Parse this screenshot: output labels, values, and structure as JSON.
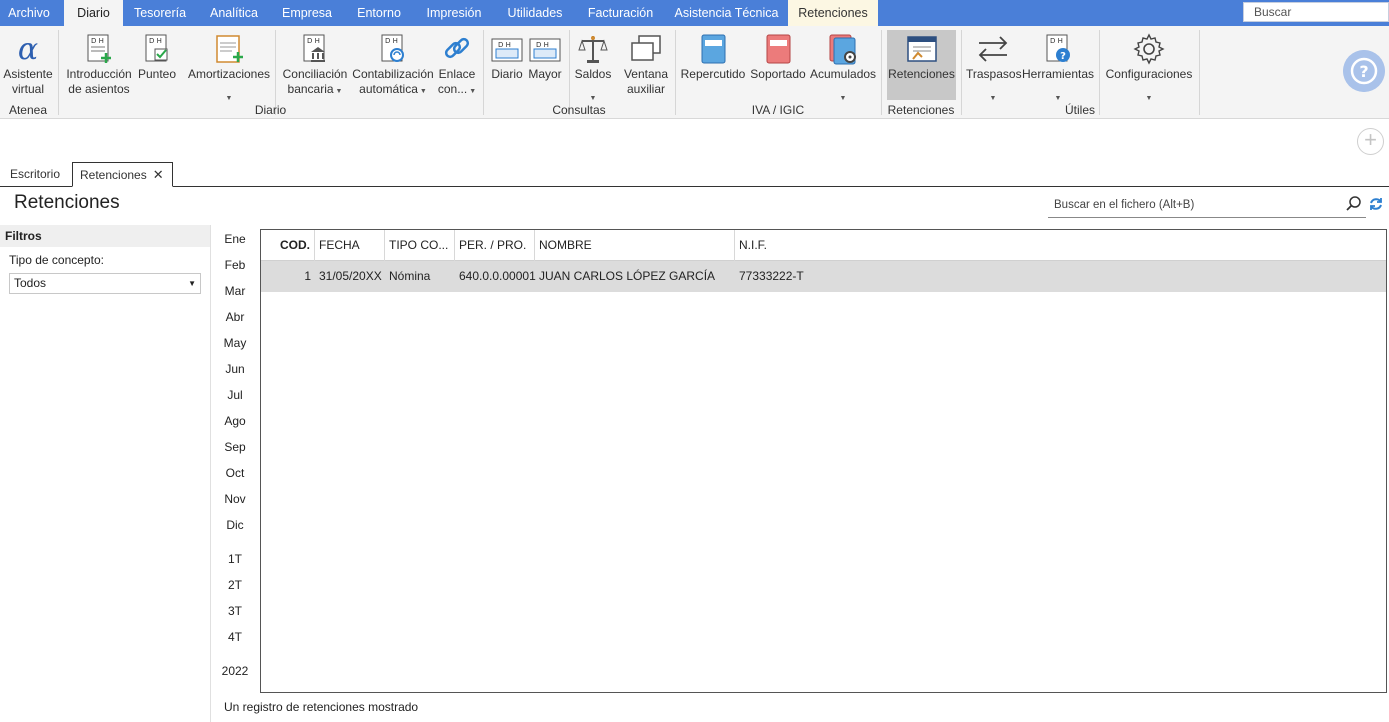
{
  "menu": {
    "tabs": [
      "Archivo",
      "Diario",
      "Tesorería",
      "Analítica",
      "Empresa",
      "Entorno",
      "Impresión",
      "Utilidades",
      "Facturación",
      "Asistencia Técnica",
      "Retenciones"
    ],
    "search_placeholder": "Buscar"
  },
  "ribbon": {
    "buttons": {
      "asistente": [
        "Asistente",
        "virtual"
      ],
      "introduccion": [
        "Introducción",
        "de asientos"
      ],
      "punteo": [
        "Punteo"
      ],
      "amortizaciones": [
        "Amortizaciones"
      ],
      "conciliacion": [
        "Conciliación",
        "bancaria"
      ],
      "contabilizacion": [
        "Contabilización",
        "automática"
      ],
      "enlace": [
        "Enlace",
        "con..."
      ],
      "diario": [
        "Diario"
      ],
      "mayor": [
        "Mayor"
      ],
      "saldos": [
        "Saldos"
      ],
      "ventana": [
        "Ventana",
        "auxiliar"
      ],
      "repercutido": [
        "Repercutido"
      ],
      "soportado": [
        "Soportado"
      ],
      "acumulados": [
        "Acumulados"
      ],
      "retenciones": [
        "Retenciones"
      ],
      "traspasos": [
        "Traspasos"
      ],
      "herramientas": [
        "Herramientas"
      ],
      "configuraciones": [
        "Configuraciones"
      ]
    },
    "groups": {
      "atenea": "Atenea",
      "diario": "Diario",
      "consultas": "Consultas",
      "iva": "IVA / IGIC",
      "retenciones": "Retenciones",
      "utiles": "Útiles"
    }
  },
  "doc_tabs": [
    "Escritorio",
    "Retenciones"
  ],
  "page": {
    "title": "Retenciones",
    "search_placeholder": "Buscar en el fichero (Alt+B)"
  },
  "filters": {
    "header": "Filtros",
    "concept_label": "Tipo de concepto:",
    "concept_value": "Todos"
  },
  "months": [
    "Ene",
    "Feb",
    "Mar",
    "Abr",
    "May",
    "Jun",
    "Jul",
    "Ago",
    "Sep",
    "Oct",
    "Nov",
    "Dic"
  ],
  "quarters": [
    "1T",
    "2T",
    "3T",
    "4T"
  ],
  "year": "2022",
  "grid": {
    "columns": [
      "COD.",
      "FECHA",
      "TIPO CO...",
      "PER. / PRO.",
      "NOMBRE",
      "N.I.F."
    ],
    "rows": [
      {
        "cod": "1",
        "fecha": "31/05/20XX",
        "tipo": "Nómina",
        "per": "640.0.0.00001",
        "nombre": "JUAN CARLOS LÓPEZ GARCÍA",
        "nif": "77333222-T"
      }
    ]
  },
  "status": "Un registro de retenciones mostrado",
  "colors": {
    "menubar": "#4a7fd8",
    "ribbon_bg": "#f4f4f4",
    "selected_row": "#dcdcdc",
    "help_circle": "#a9c2ea"
  }
}
